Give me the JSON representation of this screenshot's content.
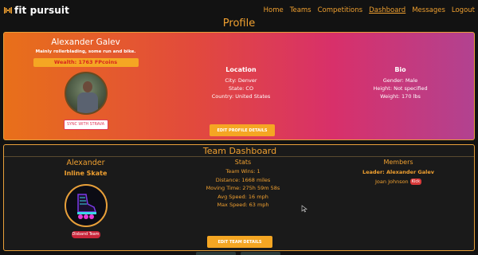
{
  "nav": {
    "brand": "fit pursuit",
    "links": [
      "Home",
      "Teams",
      "Competitions",
      "Dashboard",
      "Messages",
      "Logout"
    ],
    "active": "Dashboard"
  },
  "page_title": "Profile",
  "profile": {
    "name": "Alexander Galev",
    "tagline": "Mainly rollerblading, some run and bike.",
    "wealth": "Wealth: 1763 FPcoins",
    "strava_button": "SYNC WITH STRAVA",
    "location": {
      "heading": "Location",
      "city": "City: Denver",
      "state": "State: CO",
      "country": "Country: United States"
    },
    "bio": {
      "heading": "Bio",
      "gender": "Gender: Male",
      "height": "Height: Not specified",
      "weight": "Weight: 170 lbs"
    },
    "edit_button": "EDIT PROFILE DETAILS"
  },
  "team": {
    "title": "Team Dashboard",
    "name": "Alexander",
    "sport": "Inline Skate",
    "disband_button": "Disband Team",
    "stats": {
      "heading": "Stats",
      "wins": "Team Wins: 1",
      "distance": "Distance: 1668 miles",
      "moving_time": "Moving Time: 275h 59m 58s",
      "avg_speed": "Avg Speed: 16 mph",
      "max_speed": "Max Speed: 63 mph"
    },
    "members": {
      "heading": "Members",
      "leader": "Leader: Alexander Galev",
      "list": [
        {
          "name": "Joan Johnson",
          "kick": "Kick"
        }
      ]
    },
    "edit_button": "EDIT TEAM DETAILS"
  },
  "colors": {
    "accent": "#f0a030",
    "profile_gradient_start": "#e8701a",
    "profile_gradient_end": "#b24290",
    "danger": "#c8253a",
    "background": "#121212"
  }
}
